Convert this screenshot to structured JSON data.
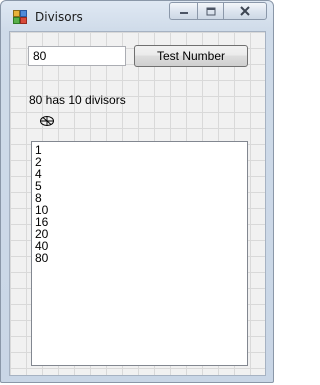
{
  "window": {
    "title": "Divisors",
    "icons": {
      "app": "app-window-icon",
      "minimize": "minimize-icon",
      "maximize": "maximize-icon",
      "close": "close-icon",
      "busy": "pencil-busy-icon"
    }
  },
  "form": {
    "number_value": "80",
    "test_button_label": "Test Number",
    "result_text": "80 has 10 divisors"
  },
  "divisors": [
    "1",
    "2",
    "4",
    "5",
    "8",
    "10",
    "16",
    "20",
    "40",
    "80"
  ]
}
